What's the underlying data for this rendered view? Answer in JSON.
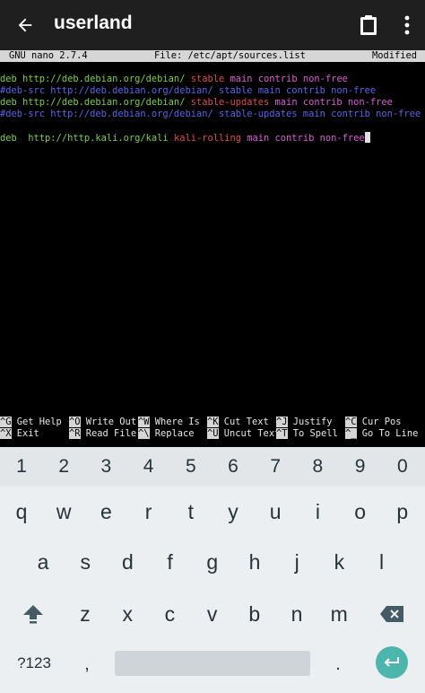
{
  "appbar": {
    "title": "userland",
    "back_icon": "arrow-left-icon",
    "clipboard_icon": "clipboard-icon",
    "menu_icon": "more-vert-icon"
  },
  "nano": {
    "header": {
      "version": "GNU nano 2.7.4",
      "file": "File: /etc/apt/sources.list",
      "status": "Modified"
    },
    "lines": [
      [
        {
          "t": "deb ",
          "c": "green"
        },
        {
          "t": "http://deb.debian.org/debian/ ",
          "c": "green"
        },
        {
          "t": "stable ",
          "c": "red"
        },
        {
          "t": "main contrib non-free",
          "c": "magenta"
        }
      ],
      [
        {
          "t": "#deb-src http://deb.debian.org/debian/ stable main contrib non-free",
          "c": "blue"
        }
      ],
      [
        {
          "t": "deb ",
          "c": "green"
        },
        {
          "t": "http://deb.debian.org/debian/ ",
          "c": "green"
        },
        {
          "t": "stable-updates ",
          "c": "red"
        },
        {
          "t": "main contrib non-free",
          "c": "magenta"
        }
      ],
      [
        {
          "t": "#deb-src http://deb.debian.org/debian/ stable-updates main contrib non-free",
          "c": "blue"
        }
      ],
      [],
      [
        {
          "t": "deb  ",
          "c": "green"
        },
        {
          "t": "http://http.kali.org/kali ",
          "c": "green"
        },
        {
          "t": "kali-rolling ",
          "c": "red"
        },
        {
          "t": "main contrib non-free",
          "c": "magenta"
        }
      ]
    ],
    "shortcuts_row1": [
      {
        "key": "^G",
        "label": " Get Help"
      },
      {
        "key": "^O",
        "label": " Write Out"
      },
      {
        "key": "^W",
        "label": " Where Is"
      },
      {
        "key": "^K",
        "label": " Cut Text"
      },
      {
        "key": "^J",
        "label": " Justify"
      },
      {
        "key": "^C",
        "label": " Cur Pos"
      }
    ],
    "shortcuts_row2": [
      {
        "key": "^X",
        "label": " Exit"
      },
      {
        "key": "^R",
        "label": " Read File"
      },
      {
        "key": "^\\",
        "label": " Replace"
      },
      {
        "key": "^U",
        "label": " Uncut Text"
      },
      {
        "key": "^T",
        "label": " To Spell"
      },
      {
        "key": "^_",
        "label": " Go To Line"
      }
    ]
  },
  "keyboard": {
    "numbers": [
      "1",
      "2",
      "3",
      "4",
      "5",
      "6",
      "7",
      "8",
      "9",
      "0"
    ],
    "row1": [
      "q",
      "w",
      "e",
      "r",
      "t",
      "y",
      "u",
      "i",
      "o",
      "p"
    ],
    "row2": [
      "a",
      "s",
      "d",
      "f",
      "g",
      "h",
      "j",
      "k",
      "l"
    ],
    "row3": [
      "z",
      "x",
      "c",
      "v",
      "b",
      "n",
      "m"
    ],
    "symbols_label": "?123",
    "comma": ",",
    "period": ".",
    "shift_icon": "shift-arrow-icon",
    "backspace_icon": "backspace-icon",
    "enter_icon": "enter-return-icon",
    "colors": {
      "enter": "#4db6ac",
      "appbar": "#1f1f1f"
    }
  }
}
